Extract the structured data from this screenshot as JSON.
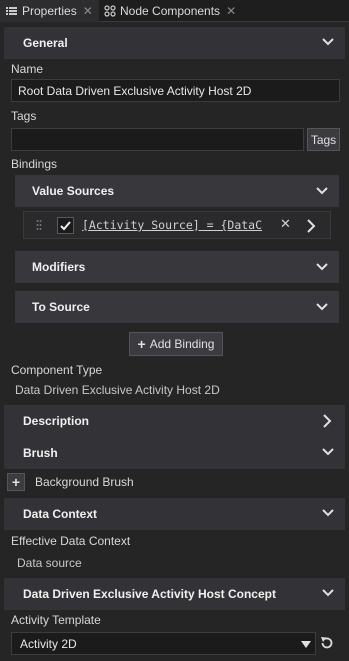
{
  "tabs": [
    {
      "label": "Properties"
    },
    {
      "label": "Node Components"
    }
  ],
  "general": {
    "header": "General",
    "name_label": "Name",
    "name_value": "Root Data Driven Exclusive Activity Host 2D",
    "tags_label": "Tags",
    "tags_value": "",
    "tags_button": "Tags",
    "bindings_label": "Bindings",
    "value_sources": "Value Sources",
    "binding_expression": "[Activity Source] = {DataC",
    "modifiers": "Modifiers",
    "to_source": "To Source",
    "add_binding": "Add Binding",
    "component_type_label": "Component Type",
    "component_type_value": "Data Driven Exclusive Activity Host 2D"
  },
  "description": {
    "header": "Description"
  },
  "brush": {
    "header": "Brush",
    "background_brush": "Background Brush"
  },
  "data_context": {
    "header": "Data Context",
    "effective_label": "Effective Data Context",
    "effective_value": "Data source"
  },
  "concept": {
    "header": "Data Driven Exclusive Activity Host Concept",
    "template_label": "Activity Template",
    "template_value": "Activity 2D"
  },
  "colors": {
    "background": "#252526",
    "section": "#333337",
    "field": "#1b1b1b"
  }
}
